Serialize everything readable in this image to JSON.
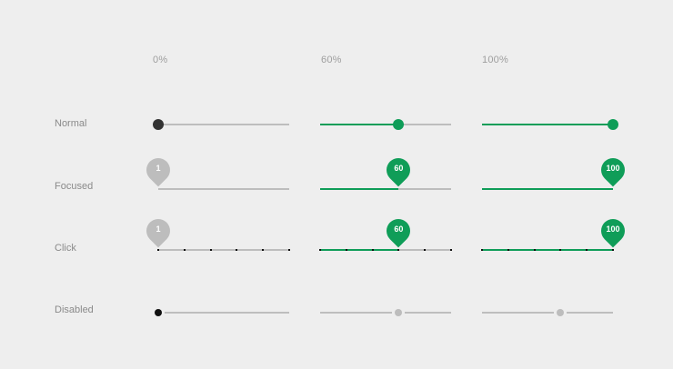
{
  "columns": [
    {
      "label": "0%",
      "value": 0
    },
    {
      "label": "60%",
      "value": 60
    },
    {
      "label": "100%",
      "value": 100
    }
  ],
  "rows": {
    "normal": "Normal",
    "focused": "Focused",
    "click": "Click",
    "disabled": "Disabled"
  },
  "pins": {
    "min": "1",
    "mid": "60",
    "max": "100"
  },
  "colors": {
    "accent": "#0f9d58",
    "track": "#bdbdbd",
    "thumb_zero": "#333333",
    "background": "#eeeeee"
  }
}
